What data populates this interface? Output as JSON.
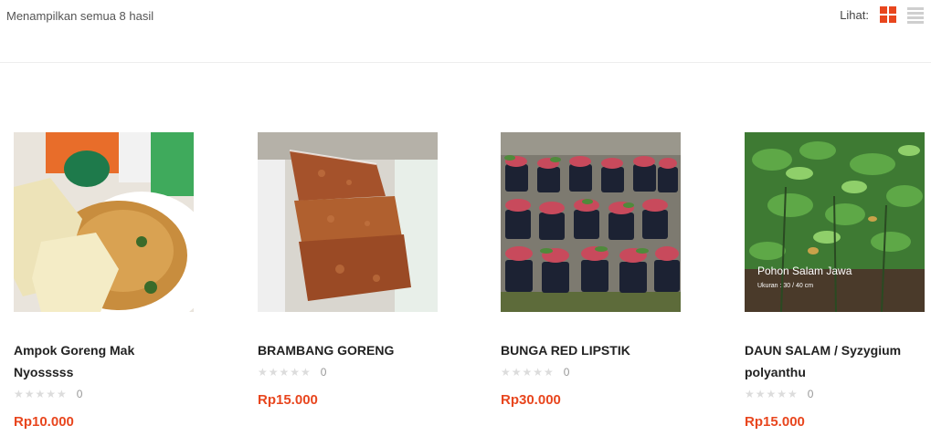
{
  "toolbar": {
    "result_count": "Menampilkan semua 8 hasil",
    "view_label": "Lihat:",
    "active_view": "grid",
    "accent_color": "#e8461e"
  },
  "products": [
    {
      "title": "Ampok Goreng Mak Nyosssss",
      "rating_count": "0",
      "price": "Rp10.000",
      "image_icon": "fried-corn-rice-photo"
    },
    {
      "title": "BRAMBANG GORENG",
      "rating_count": "0",
      "price": "Rp15.000",
      "image_icon": "fried-shallots-bags-photo"
    },
    {
      "title": "BUNGA RED LIPSTIK",
      "rating_count": "0",
      "price": "Rp30.000",
      "image_icon": "potted-plants-photo"
    },
    {
      "title": "DAUN SALAM / Syzygium polyanthu",
      "rating_count": "0",
      "price": "Rp15.000",
      "image_icon": "bay-leaf-tree-photo",
      "image_caption": "Pohon Salam Jawa",
      "image_subcaption": "Ukuran : 30 / 40 cm"
    }
  ]
}
